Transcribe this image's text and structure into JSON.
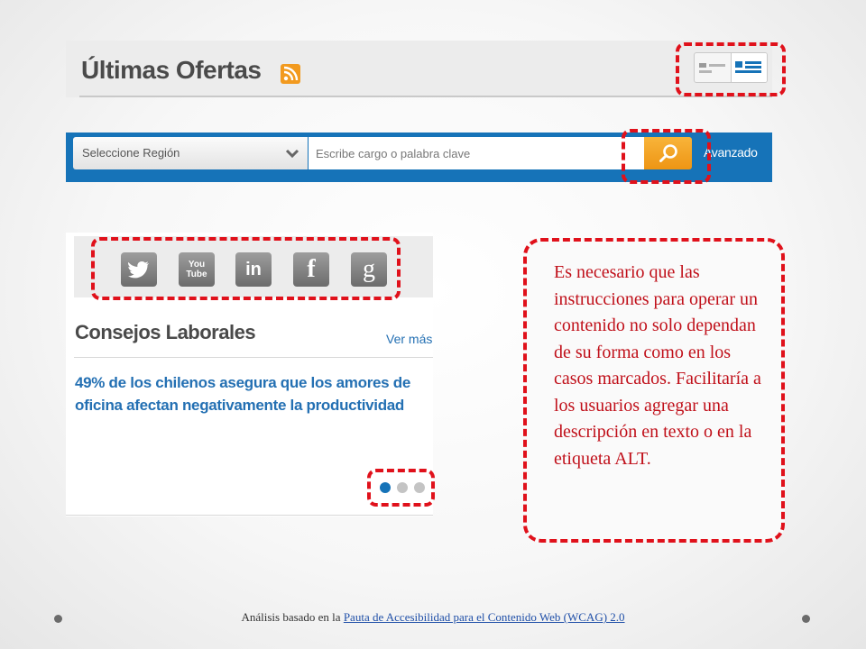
{
  "header": {
    "title": "Últimas Ofertas"
  },
  "search": {
    "region_label": "Seleccione Región",
    "placeholder": "Escribe cargo o palabra clave",
    "advanced_label": "Avanzado"
  },
  "social": [
    "twitter",
    "youtube",
    "linkedin",
    "facebook",
    "google"
  ],
  "social_youtube_text": [
    "You",
    "Tube"
  ],
  "social_linkedin_text": "in",
  "social_facebook_text": "f",
  "social_google_text": "g",
  "tips": {
    "title": "Consejos Laborales",
    "more_link": "Ver más",
    "article": "49% de los chilenos asegura que los amores de oficina afectan negativamente la productividad",
    "carousel_active_index": 0,
    "carousel_total": 3
  },
  "note": {
    "text": "Es necesario que las instrucciones para operar un contenido no solo dependan de su forma como en los casos marcados. Facilitaría a los usuarios agregar una descripción en texto o en la etiqueta ALT."
  },
  "footer": {
    "prefix": "Análisis basado en la ",
    "link_text": "Pauta de Accesibilidad para el Contenido Web (WCAG) 2.0"
  },
  "colors": {
    "brand_blue": "#1673b8",
    "marker_red": "#e0111b",
    "search_orange": "#f2a12a",
    "note_red": "#c0101a"
  }
}
